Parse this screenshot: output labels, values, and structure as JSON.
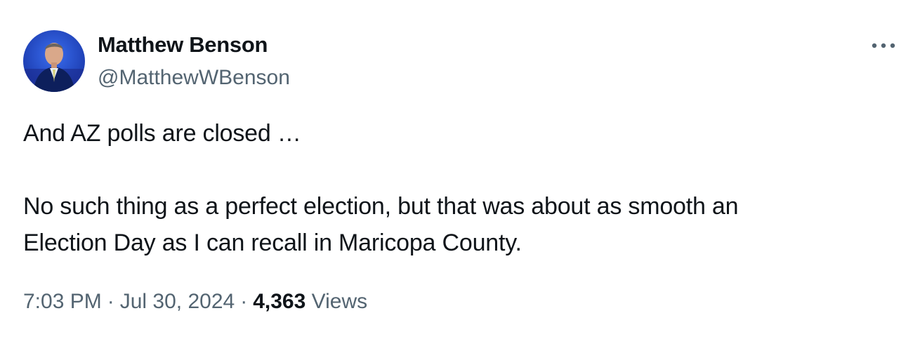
{
  "author": {
    "display_name": "Matthew Benson",
    "handle": "@MatthewWBenson",
    "avatar_icon": "profile-photo"
  },
  "more_icon": "ellipsis-icon",
  "tweet": {
    "lines": [
      "And AZ polls are closed …",
      "",
      "No such thing as a perfect election, but that was about as smooth an",
      "Election Day as I can recall in Maricopa County."
    ]
  },
  "meta": {
    "time": "7:03 PM",
    "separator": "·",
    "date": "Jul 30, 2024",
    "views_count": "4,363",
    "views_label": "Views"
  },
  "colors": {
    "text_primary": "#0f1419",
    "text_secondary": "#536471",
    "avatar_background": "#1c3aa9"
  }
}
